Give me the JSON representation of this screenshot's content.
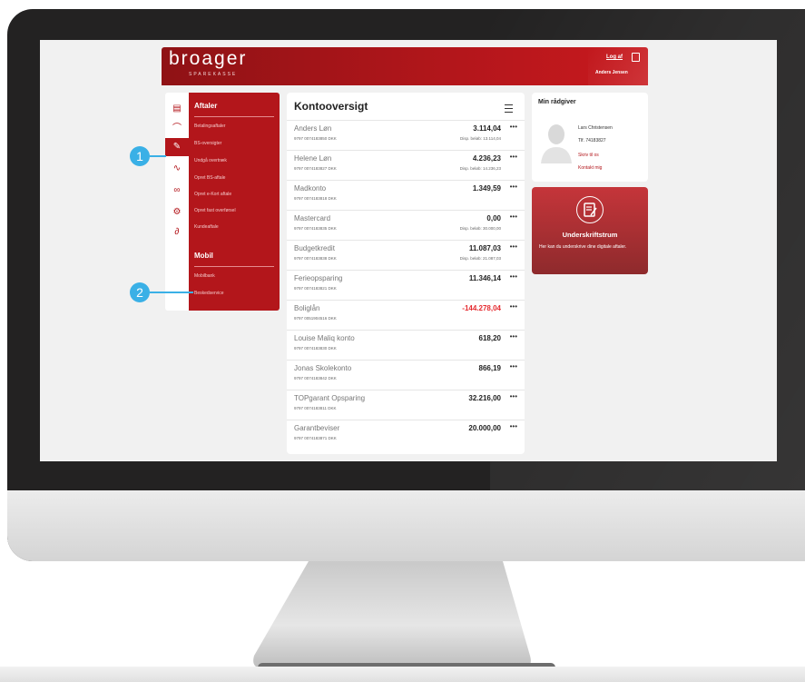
{
  "brand": {
    "name": "broager",
    "sub": "SPAREKASSE"
  },
  "header": {
    "logout": "Log af",
    "user": "Anders Jensen"
  },
  "menu": {
    "aftaler_title": "Aftaler",
    "aftaler_items": [
      "Betalingsaftaler",
      "BS-oversigter",
      "Undgå overtræk",
      "Opret BS-aftale",
      "Opret e-Kort aftale",
      "Opret fast overførsel",
      "Kundeaftale"
    ],
    "mobil_title": "Mobil",
    "mobil_items": [
      "Mobilbank",
      "Beskedservice"
    ]
  },
  "accounts": {
    "title": "Kontooversigt",
    "rows": [
      {
        "name": "Anders Løn",
        "number": "9797 0074183850 DKK",
        "amount": "3.114,04",
        "disp": "Disp. beløb: 13.114,04"
      },
      {
        "name": "Helene Løn",
        "number": "9797 0074183827 DKK",
        "amount": "4.236,23",
        "disp": "Disp. beløb: 14.236,23"
      },
      {
        "name": "Madkonto",
        "number": "9797 0074183818 DKK",
        "amount": "1.349,59",
        "disp": ""
      },
      {
        "name": "Mastercard",
        "number": "9797 0074183835 DKK",
        "amount": "0,00",
        "disp": "Disp. beløb: 30.000,00"
      },
      {
        "name": "Budgetkredit",
        "number": "9797 0074183838 DKK",
        "amount": "11.087,03",
        "disp": "Disp. beløb: 21.087,03"
      },
      {
        "name": "Ferieopsparing",
        "number": "9797 0074183821 DKK",
        "amount": "11.346,14",
        "disp": ""
      },
      {
        "name": "Boliglån",
        "number": "9797 0051904516 DKK",
        "amount": "-144.278,04",
        "disp": ""
      },
      {
        "name": "Louise Maliq konto",
        "number": "9797 0074183830 DKK",
        "amount": "618,20",
        "disp": ""
      },
      {
        "name": "Jonas Skolekonto",
        "number": "9797 0074183842 DKK",
        "amount": "866,19",
        "disp": ""
      },
      {
        "name": "TOPgarant Opsparing",
        "number": "9797 0074183811 DKK",
        "amount": "32.216,00",
        "disp": ""
      },
      {
        "name": "Garantbeviser",
        "number": "9797 0074183871 DKK",
        "amount": "20.000,00",
        "disp": ""
      }
    ]
  },
  "advisor": {
    "title": "Min rådgiver",
    "name": "Lars Christensen",
    "phone": "Tlf. 74183827",
    "write": "Skriv til os",
    "contact": "Kontakt mig"
  },
  "signing": {
    "title": "Underskriftstrum",
    "desc": "Her kan du underskrive dine digitale aftaler."
  },
  "callouts": [
    "1",
    "2"
  ],
  "colors": {
    "brand": "#b3161b",
    "callout": "#3ab0e6",
    "negative": "#e52a2f"
  }
}
